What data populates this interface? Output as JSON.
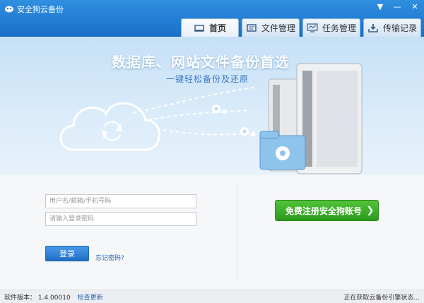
{
  "window": {
    "title": "安全狗云备份",
    "buttons": {
      "menu": "▼",
      "minimize": "—",
      "close": "✕"
    }
  },
  "tabs": [
    {
      "label": "首页",
      "icon": "home-icon",
      "active": true
    },
    {
      "label": "文件管理",
      "icon": "file-manage-icon",
      "active": false
    },
    {
      "label": "任务管理",
      "icon": "task-manage-icon",
      "active": false
    },
    {
      "label": "传输记录",
      "icon": "download-icon",
      "active": false
    }
  ],
  "banner": {
    "title": "数据库、网站文件备份首选",
    "subtitle": "一键轻松备份及还原"
  },
  "login": {
    "username_placeholder": "用户名/邮箱/手机号码",
    "password_placeholder": "请输入登录密码",
    "login_label": "登录",
    "forgot_label": "忘记密码?",
    "register_label": "免费注册安全狗账号"
  },
  "status": {
    "version": "软件版本： 1.4.00010",
    "check_update": "检查更新",
    "engine_status": "正在获取云备份引擎状态..."
  },
  "colors": {
    "titlebar": "#1a6fc8",
    "register_button": "#3aaa28",
    "login_button": "#1f6dc4"
  }
}
